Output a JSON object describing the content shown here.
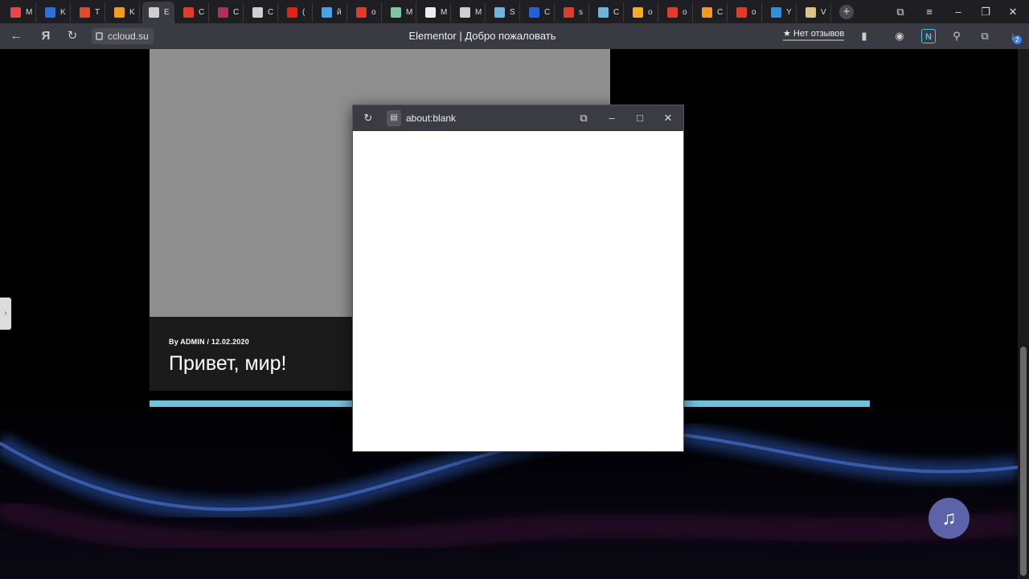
{
  "tabs": [
    {
      "label": "M",
      "color": "#e9464b"
    },
    {
      "label": "K",
      "color": "#2f6fd8"
    },
    {
      "label": "T",
      "color": "#e24a2b"
    },
    {
      "label": "K",
      "color": "#f29b1c"
    },
    {
      "label": "E",
      "color": "#cfcfcf",
      "active": true
    },
    {
      "label": "C",
      "color": "#e23b2b"
    },
    {
      "label": "C",
      "color": "#b0305c"
    },
    {
      "label": "C",
      "color": "#cfcfcf"
    },
    {
      "label": "(",
      "color": "#e62117"
    },
    {
      "label": "й",
      "color": "#4aa3e0"
    },
    {
      "label": "o",
      "color": "#e23b2b"
    },
    {
      "label": "M",
      "color": "#7fc6a4"
    },
    {
      "label": "M",
      "color": "#eeeeee"
    },
    {
      "label": "M",
      "color": "#cfcfcf"
    },
    {
      "label": "S",
      "color": "#6fb5e0"
    },
    {
      "label": "C",
      "color": "#2660d6"
    },
    {
      "label": "s",
      "color": "#e23b2b"
    },
    {
      "label": "C",
      "color": "#6fb5e0"
    },
    {
      "label": "o",
      "color": "#f2b01c"
    },
    {
      "label": "o",
      "color": "#e23b2b"
    },
    {
      "label": "C",
      "color": "#f29b1c"
    },
    {
      "label": "o",
      "color": "#e23b2b"
    },
    {
      "label": "Y",
      "color": "#2b90e0"
    },
    {
      "label": "V",
      "color": "#d9c58a"
    }
  ],
  "nav": {
    "address": "ccloud.su",
    "title": "Elementor | Добро пожаловать",
    "reviews": "★ Нет отзывов",
    "downloads_badge": "2"
  },
  "post": {
    "meta": "By ADMIN  /  12.02.2020",
    "title": "Привет, мир!"
  },
  "popup": {
    "url": "about:blank"
  },
  "icons": {
    "music": "music-note-icon"
  },
  "colors": {
    "progress": "#6fc2de",
    "music_button": "#5c63a8"
  }
}
